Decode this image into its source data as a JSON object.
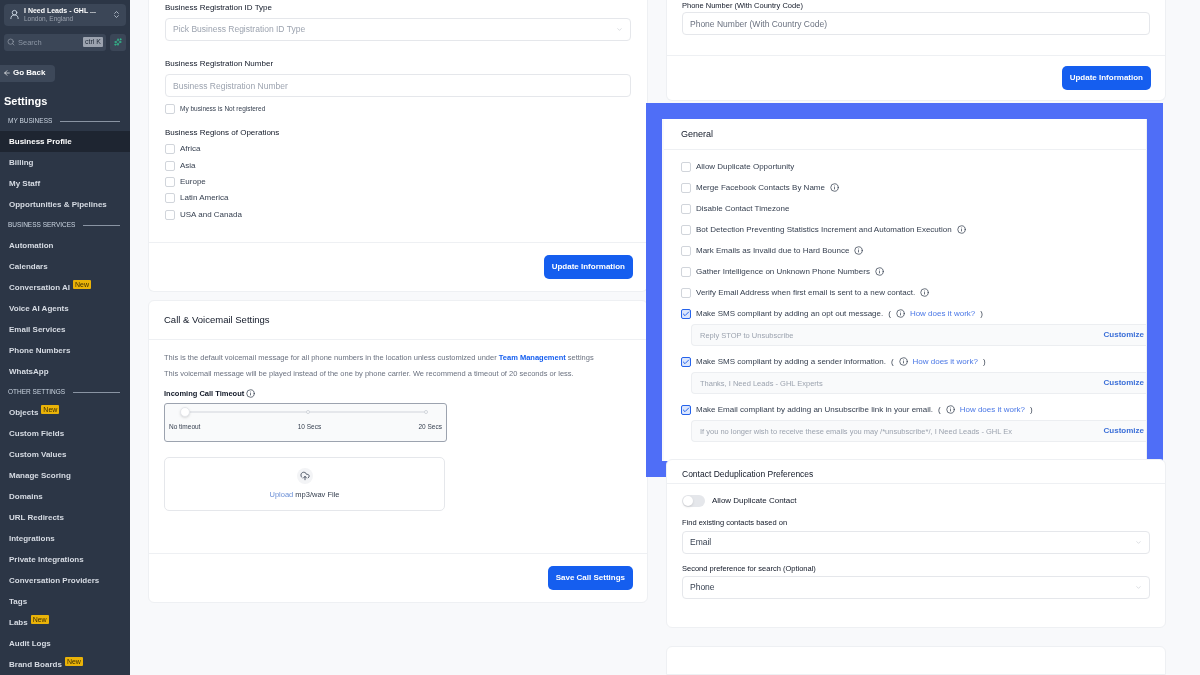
{
  "sidebar": {
    "account": {
      "name": "I Need Leads - GHL ...",
      "location": "London, England"
    },
    "search": {
      "placeholder": "Search",
      "shortcut": "ctrl K"
    },
    "go_back": "Go Back",
    "title": "Settings",
    "sections": [
      {
        "heading": "MY BUSINESS",
        "items": [
          {
            "label": "Business Profile",
            "selected": true
          },
          {
            "label": "Billing",
            "selected": false
          },
          {
            "label": "My Staff",
            "selected": false
          },
          {
            "label": "Opportunities & Pipelines",
            "selected": false
          }
        ]
      },
      {
        "heading": "BUSINESS SERVICES",
        "items": [
          {
            "label": "Automation",
            "selected": false
          },
          {
            "label": "Calendars",
            "selected": false
          },
          {
            "label": "Conversation AI",
            "selected": false,
            "badge": "New"
          },
          {
            "label": "Voice AI Agents",
            "selected": false
          },
          {
            "label": "Email Services",
            "selected": false
          },
          {
            "label": "Phone Numbers",
            "selected": false
          },
          {
            "label": "WhatsApp",
            "selected": false
          }
        ]
      },
      {
        "heading": "OTHER SETTINGS",
        "items": [
          {
            "label": "Objects",
            "selected": false,
            "badge": "New"
          },
          {
            "label": "Custom Fields",
            "selected": false
          },
          {
            "label": "Custom Values",
            "selected": false
          },
          {
            "label": "Manage Scoring",
            "selected": false
          },
          {
            "label": "Domains",
            "selected": false
          },
          {
            "label": "URL Redirects",
            "selected": false
          },
          {
            "label": "Integrations",
            "selected": false
          },
          {
            "label": "Private Integrations",
            "selected": false
          },
          {
            "label": "Conversation Providers",
            "selected": false
          },
          {
            "label": "Tags",
            "selected": false
          },
          {
            "label": "Labs",
            "selected": false,
            "badge": "New"
          },
          {
            "label": "Audit Logs",
            "selected": false
          },
          {
            "label": "Brand Boards",
            "selected": false,
            "badge": "New"
          }
        ]
      }
    ]
  },
  "registration": {
    "id_type": {
      "label": "Business Registration ID Type",
      "placeholder": "Pick Business Registration ID Type"
    },
    "number": {
      "label": "Business Registration Number",
      "placeholder": "Business Registration Number"
    },
    "not_registered": {
      "label": "My business is Not registered",
      "checked": false
    },
    "regions_label": "Business Regions of Operations",
    "regions": [
      {
        "label": "Africa",
        "checked": false
      },
      {
        "label": "Asia",
        "checked": false
      },
      {
        "label": "Europe",
        "checked": false
      },
      {
        "label": "Latin America",
        "checked": false
      },
      {
        "label": "USA and Canada",
        "checked": false
      }
    ],
    "button": "Update Information"
  },
  "call_settings": {
    "title": "Call & Voicemail Settings",
    "description": "This is the default voicemail message for all phone numbers in the location unless customized under",
    "link": "Team Management",
    "description_end": "settings",
    "note": "This voicemail message will be played instead of the one by phone carrier. We recommend a timeout of 20 seconds or less.",
    "timeout": {
      "label": "Incoming Call Timeout",
      "level": 0,
      "marks": [
        "No timeout",
        "10 Secs",
        "20 Secs"
      ]
    },
    "upload": {
      "link": "Upload",
      "text": "mp3/wav File"
    },
    "button": "Save Call Settings"
  },
  "phone": {
    "label": "Phone Number (With Country Code)",
    "placeholder": "Phone Number (With Country Code)",
    "button": "Update Information"
  },
  "general": {
    "title": "General",
    "options": [
      {
        "label": "Allow Duplicate Opportunity",
        "checked": false,
        "info": false
      },
      {
        "label": "Merge Facebook Contacts By Name",
        "checked": false,
        "info": true
      },
      {
        "label": "Disable Contact Timezone",
        "checked": false,
        "info": false
      },
      {
        "label": "Bot Detection Preventing Statistics Increment and Automation Execution",
        "checked": false,
        "info": true
      },
      {
        "label": "Mark Emails as Invalid due to Hard Bounce",
        "checked": false,
        "info": true
      },
      {
        "label": "Gather Intelligence on Unknown Phone Numbers",
        "checked": false,
        "info": true
      },
      {
        "label": "Verify Email Address when first email is sent to a new contact.",
        "checked": false,
        "info": true
      },
      {
        "label": "Make SMS compliant by adding an opt out message.",
        "checked": true,
        "info": true,
        "paren_open": "(",
        "paren_close": ")",
        "link": "How does it work?",
        "message": "Reply STOP to Unsubscribe",
        "action": "Customize"
      },
      {
        "label": "Make SMS compliant by adding a sender information.",
        "checked": true,
        "info": true,
        "paren_open": "(",
        "paren_close": ")",
        "link": "How does it work?",
        "message": "Thanks, I Need Leads - GHL Experts",
        "action": "Customize"
      },
      {
        "label": "Make Email compliant by adding an Unsubscribe link in your email.",
        "checked": true,
        "info": true,
        "paren_open": "(",
        "paren_close": ")",
        "link": "How does it work?",
        "message": "If you no longer wish to receive these emails you may /*unsubscribe*/, I Need Leads - GHL Ex",
        "action": "Customize"
      }
    ]
  },
  "dedup": {
    "title": "Contact Deduplication Preferences",
    "toggle": {
      "label": "Allow Duplicate Contact",
      "on": false
    },
    "first": {
      "label": "Find existing contacts based on",
      "value": "Email"
    },
    "second": {
      "label": "Second preference for search (Optional)",
      "value": "Phone"
    }
  }
}
